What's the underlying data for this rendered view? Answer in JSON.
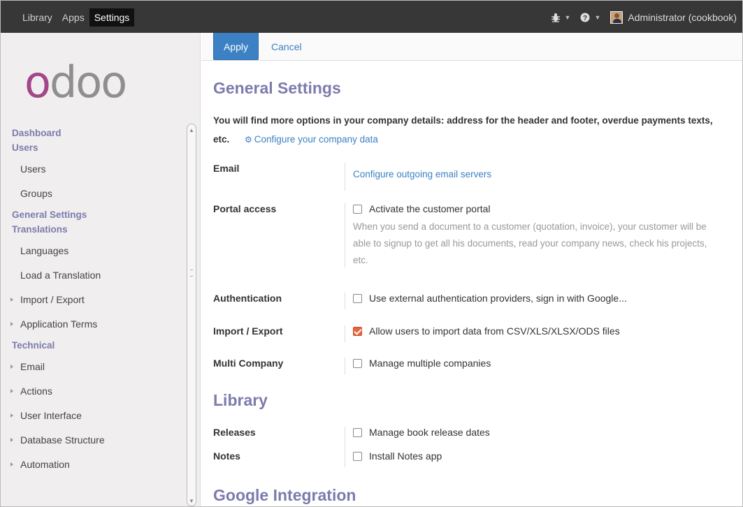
{
  "topbar": {
    "nav": [
      "Library",
      "Apps",
      "Settings"
    ],
    "active": "Settings",
    "user_name": "Administrator (cookbook)",
    "bug_icon": "bug-icon",
    "help_icon": "question-circle-icon"
  },
  "sidebar": {
    "logo_text": "odoo",
    "menu": [
      {
        "type": "head",
        "label": "Dashboard"
      },
      {
        "type": "head",
        "label": "Users"
      },
      {
        "type": "item",
        "label": "Users"
      },
      {
        "type": "item",
        "label": "Groups"
      },
      {
        "type": "head",
        "label": "General Settings"
      },
      {
        "type": "head",
        "label": "Translations"
      },
      {
        "type": "item",
        "label": "Languages"
      },
      {
        "type": "item",
        "label": "Load a Translation"
      },
      {
        "type": "folder",
        "label": "Import / Export"
      },
      {
        "type": "folder",
        "label": "Application Terms"
      },
      {
        "type": "head",
        "label": "Technical"
      },
      {
        "type": "folder",
        "label": "Email"
      },
      {
        "type": "folder",
        "label": "Actions"
      },
      {
        "type": "folder",
        "label": "User Interface"
      },
      {
        "type": "folder",
        "label": "Database Structure"
      },
      {
        "type": "folder",
        "label": "Automation"
      }
    ]
  },
  "actions": {
    "apply": "Apply",
    "cancel": "Cancel"
  },
  "general": {
    "title": "General Settings",
    "intro": "You will find more options in your company details: address for the header and footer, overdue payments texts, etc.",
    "company_link": "Configure your company data",
    "email_label": "Email",
    "email_link": "Configure outgoing email servers",
    "portal_label": "Portal access",
    "portal_option": "Activate the customer portal",
    "portal_help": "When you send a document to a customer (quotation, invoice), your customer will be able to signup to get all his documents, read your company news, check his projects, etc.",
    "auth_label": "Authentication",
    "auth_option": "Use external authentication providers, sign in with Google...",
    "import_label": "Import / Export",
    "import_option": "Allow users to import data from CSV/XLS/XLSX/ODS files",
    "multi_label": "Multi Company",
    "multi_option": "Manage multiple companies"
  },
  "library": {
    "title": "Library",
    "releases_label": "Releases",
    "releases_option": "Manage book release dates",
    "notes_label": "Notes",
    "notes_option": "Install Notes app"
  },
  "google": {
    "title": "Google Integration"
  },
  "checkbox_state": {
    "portal": false,
    "auth": false,
    "import": true,
    "multi": false,
    "releases": false,
    "notes": false
  },
  "colors": {
    "accent": "#7c7bad",
    "link": "#3c81c3",
    "topbar": "#373737",
    "brand": "#a24689"
  }
}
